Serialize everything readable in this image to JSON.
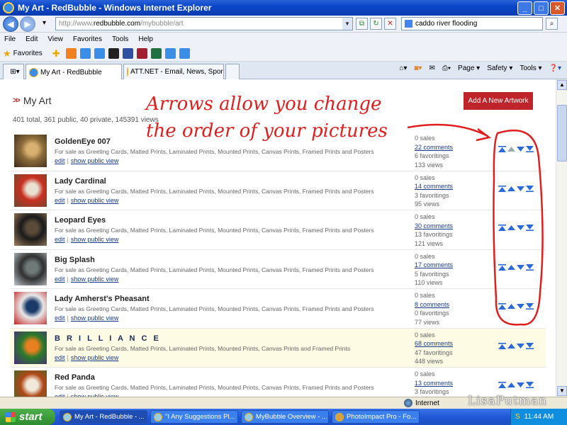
{
  "window": {
    "title": "My Art - RedBubble - Windows Internet Explorer",
    "min": "_",
    "max": "□",
    "close": "✕"
  },
  "address": {
    "prefix": "http://www.",
    "domain": "redbubble.com",
    "path": "/mybubble/art"
  },
  "search": {
    "value": "caddo river flooding"
  },
  "menu": [
    "File",
    "Edit",
    "View",
    "Favorites",
    "Tools",
    "Help"
  ],
  "favorites": {
    "label": "Favorites"
  },
  "tabs": [
    {
      "label": "My Art - RedBubble"
    },
    {
      "label": "ATT.NET - Email, News, Spor..."
    }
  ],
  "commandbar": {
    "page": "Page ▾",
    "safety": "Safety ▾",
    "tools": "Tools ▾"
  },
  "page": {
    "heading": "My Art",
    "summary": "401 total, 361 public, 40 private, 145391 views",
    "add_button": "Add A New Artwork",
    "annotation_line1": "Arrows allow you change",
    "annotation_line2": "the order of your pictures",
    "forsale_full": "For sale as Greeting Cards, Matted Prints, Laminated Prints, Mounted Prints, Canvas Prints, Framed Prints and Posters",
    "forsale_noposters": "For sale as Greeting Cards, Matted Prints, Laminated Prints, Mounted Prints, Canvas Prints and Framed Prints",
    "edit_label": "edit",
    "public_label": "show public view",
    "sep": "|"
  },
  "artworks": [
    {
      "title": "GoldenEye 007",
      "sales": "0 sales",
      "comments": "22 comments",
      "favs": "6 favoritings",
      "views": "133 views",
      "colors": [
        "#8a6a3a",
        "#d8b070",
        "#3a2a18"
      ]
    },
    {
      "title": "Lady Cardinal",
      "sales": "0 sales",
      "comments": "14 comments",
      "favs": "3 favoritings",
      "views": "95 views",
      "colors": [
        "#c83020",
        "#e8e0d0",
        "#6a4a30"
      ]
    },
    {
      "title": "Leopard Eyes",
      "sales": "0 sales",
      "comments": "30 comments",
      "favs": "13 favoritings",
      "views": "121 views",
      "colors": [
        "#1a1a1a",
        "#5a4a38",
        "#a08060"
      ]
    },
    {
      "title": "Big Splash",
      "sales": "0 sales",
      "comments": "17 comments",
      "favs": "5 favoritings",
      "views": "110 views",
      "colors": [
        "#303030",
        "#707878",
        "#c0c8cc"
      ]
    },
    {
      "title": "Lady Amherst's Pheasant",
      "sales": "0 sales",
      "comments": "8 comments",
      "favs": "0 favoritings",
      "views": "77 views",
      "colors": [
        "#e8e8e8",
        "#1a3a6a",
        "#c02020"
      ]
    },
    {
      "title": "B R I L L I A N C E",
      "sales": "0 sales",
      "comments": "68 comments",
      "favs": "47 favoritings",
      "views": "448 views",
      "colors": [
        "#2a7a2a",
        "#e88020",
        "#4a2a7a"
      ],
      "featured": true,
      "noposters": true
    },
    {
      "title": "Red Panda",
      "sales": "0 sales",
      "comments": "13 comments",
      "favs": "3 favoritings",
      "views": "",
      "colors": [
        "#b04818",
        "#f0e8d8",
        "#3a6a2a"
      ]
    }
  ],
  "status": {
    "zone": "Internet"
  },
  "taskbar": {
    "start": "start",
    "tasks": [
      "My Art - RedBubble - ...",
      "\"I Any Suggestions Pl...",
      "MyBubble Overview - ...",
      "PhotoImpact Pro - Fo..."
    ],
    "time": "11:44 AM"
  },
  "watermark": "LisaPutman",
  "colors": {
    "accent_red": "#c0242b",
    "link": "#1a3b8a",
    "arrow_blue": "#2a6ad8",
    "annotation": "#e01e1e"
  }
}
